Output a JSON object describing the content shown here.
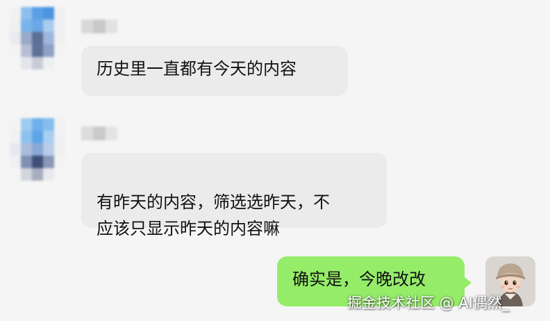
{
  "messages": [
    {
      "side": "left",
      "text": "历史里一直都有今天的内容"
    },
    {
      "side": "left",
      "text": "有昨天的内容，筛选选昨天，不\n应该只显示昨天的内容嘛"
    },
    {
      "side": "right",
      "text": "确实是，今晚改改"
    }
  ],
  "watermark": "掘金技术社区 @ AI偶然_",
  "colors": {
    "background": "#f5f5f5",
    "incoming_bubble": "#ebebeb",
    "outgoing_bubble": "#95ec69"
  }
}
